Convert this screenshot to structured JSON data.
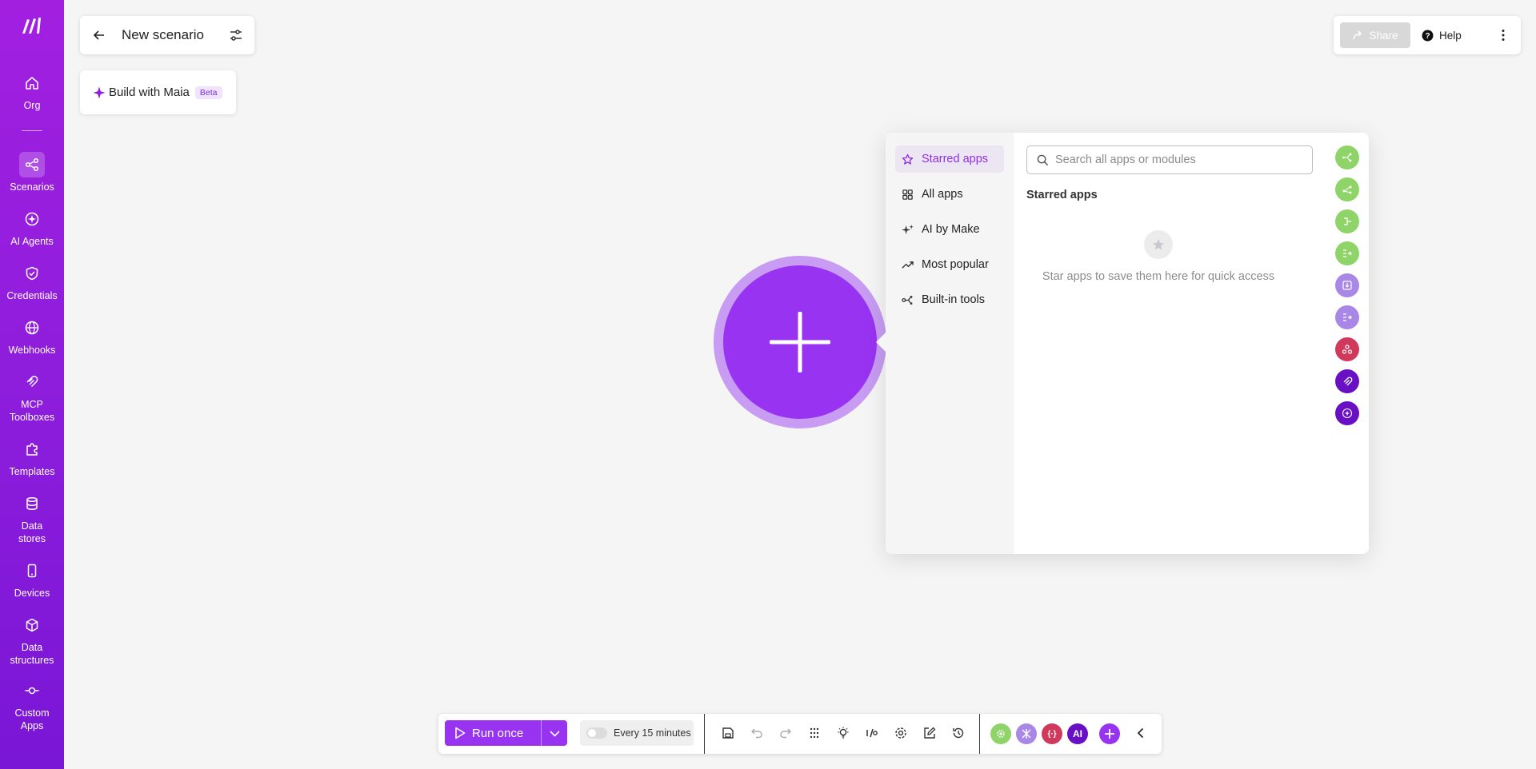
{
  "sidebar": {
    "items": [
      {
        "label": "Org",
        "icon": "home-icon"
      },
      {
        "label": "Scenarios",
        "icon": "share-nodes-icon"
      },
      {
        "label": "AI Agents",
        "icon": "ai-agent-icon"
      },
      {
        "label": "Credentials",
        "icon": "shield-check-icon"
      },
      {
        "label": "Webhooks",
        "icon": "globe-icon"
      },
      {
        "label": "MCP Toolboxes",
        "icon": "mcp-icon"
      },
      {
        "label": "Templates",
        "icon": "puzzle-icon"
      },
      {
        "label": "Data stores",
        "icon": "database-icon"
      },
      {
        "label": "Devices",
        "icon": "phone-icon"
      },
      {
        "label": "Data structures",
        "icon": "cube-icon"
      },
      {
        "label": "Custom Apps",
        "icon": "commit-icon"
      }
    ],
    "active": "Scenarios"
  },
  "header": {
    "title": "New scenario",
    "maia_label": "Build with Maia",
    "maia_badge": "Beta",
    "share_label": "Share",
    "help_label": "Help"
  },
  "picker": {
    "categories": [
      {
        "label": "Starred apps",
        "icon": "star-icon",
        "active": true
      },
      {
        "label": "All apps",
        "icon": "grid-icon",
        "active": false
      },
      {
        "label": "AI by Make",
        "icon": "sparkles-icon",
        "active": false
      },
      {
        "label": "Most popular",
        "icon": "trend-icon",
        "active": false
      },
      {
        "label": "Built-in tools",
        "icon": "tools-icon",
        "active": false
      }
    ],
    "search_placeholder": "Search all apps or modules",
    "section_title": "Starred apps",
    "empty_text": "Star apps to save them here for quick access",
    "tool_colors": [
      "#8fd468",
      "#8fd468",
      "#8fd468",
      "#8fd468",
      "#a987e6",
      "#a987e6",
      "#d0395c",
      "#6a10c4",
      "#6a10c4"
    ]
  },
  "toolbar": {
    "run_label": "Run once",
    "schedule_label": "Every 15 minutes",
    "apps": [
      {
        "label": "",
        "color": "#8fd468",
        "icon": "gear-icon"
      },
      {
        "label": "",
        "color": "#a987e6",
        "icon": "tools-icon"
      },
      {
        "label": "{·}",
        "color": "#d0395c",
        "icon": "json-icon"
      },
      {
        "label": "AI",
        "color": "#6a10c4",
        "icon": "ai-icon"
      }
    ]
  },
  "colors": {
    "brand": "#9933f2",
    "sidebar": "#8e1ddc"
  }
}
